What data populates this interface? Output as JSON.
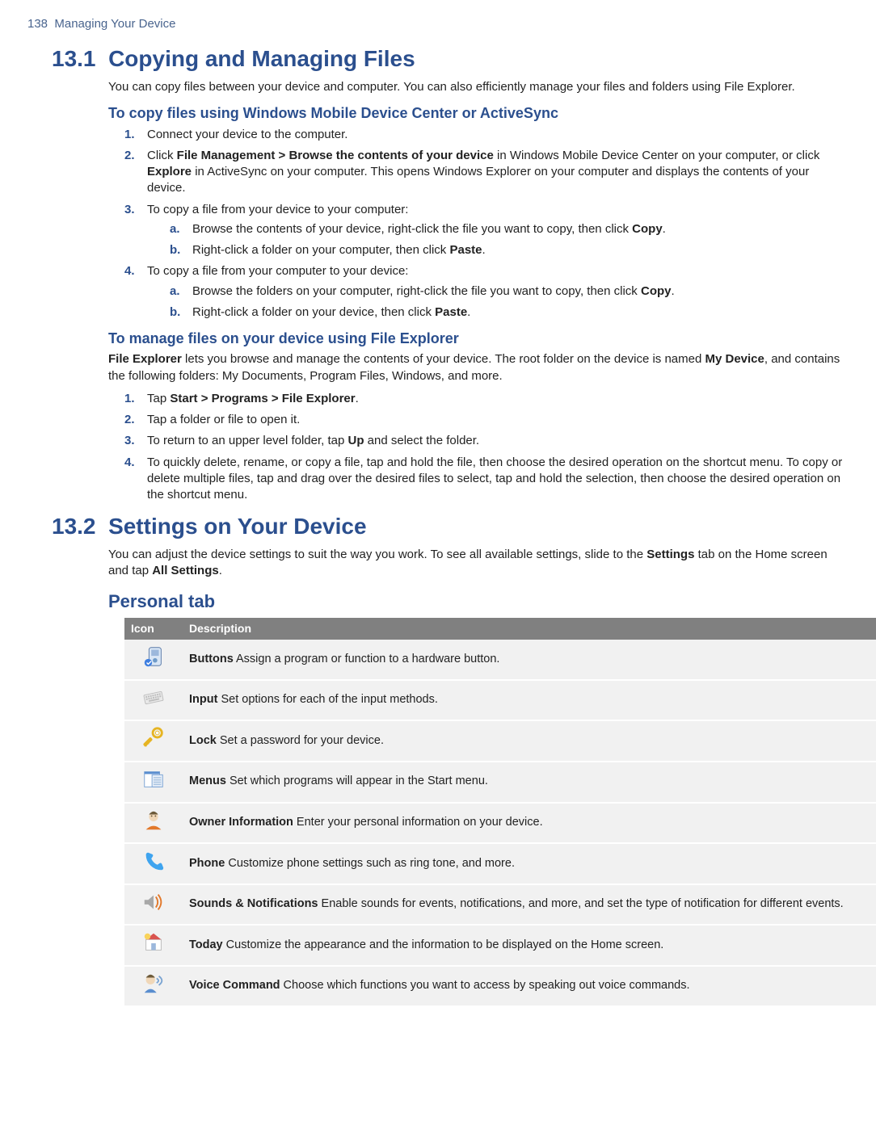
{
  "page": {
    "number": "138",
    "header": "Managing Your Device"
  },
  "section1": {
    "number": "13.1",
    "title": "Copying and Managing Files",
    "intro": "You can copy files between your device and computer. You can also efficiently manage your files and folders using File Explorer.",
    "sub1_title": "To copy files using Windows Mobile Device Center or ActiveSync",
    "s1_items": {
      "i1": "Connect your device to the computer.",
      "i2_p1": "Click ",
      "i2_b1": "File Management > Browse the contents of your device",
      "i2_p2": " in Windows Mobile Device Center on your computer, or click ",
      "i2_b2": "Explore",
      "i2_p3": " in ActiveSync on your computer. This opens Windows Explorer on your computer and displays the contents of your device.",
      "i3": "To copy a file from your device to your computer:",
      "i3a_p1": "Browse the contents of your device, right-click the file you want to copy, then click ",
      "i3a_b1": "Copy",
      "i3a_p2": ".",
      "i3b_p1": "Right-click a folder on your computer, then click ",
      "i3b_b1": "Paste",
      "i3b_p2": ".",
      "i4": "To copy a file from your computer to your device:",
      "i4a_p1": "Browse the folders on your computer, right-click the file you want to copy, then click ",
      "i4a_b1": "Copy",
      "i4a_p2": ".",
      "i4b_p1": "Right-click a folder on your device, then click ",
      "i4b_b1": "Paste",
      "i4b_p2": "."
    },
    "sub2_title": "To manage files on your device using File Explorer",
    "sub2_intro_b1": "File Explorer",
    "sub2_intro_p1": " lets you browse and manage the contents of your device. The root folder on the device is named ",
    "sub2_intro_b2": "My Device",
    "sub2_intro_p2": ", and contains the following folders: My Documents, Program Files, Windows, and more.",
    "s2_items": {
      "i1_p1": "Tap ",
      "i1_b1": "Start > Programs > File Explorer",
      "i1_p2": ".",
      "i2": "Tap a folder or file to open it.",
      "i3_p1": "To return to an upper level folder, tap ",
      "i3_b1": "Up",
      "i3_p2": " and select the folder.",
      "i4": "To quickly delete, rename, or copy a file, tap and hold the file, then choose the desired operation on the shortcut menu. To copy or delete multiple files, tap and drag over the desired files to select, tap and hold the selection, then choose the desired operation on the shortcut menu."
    }
  },
  "section2": {
    "number": "13.2",
    "title": "Settings on Your Device",
    "intro_p1": "You can adjust the device settings to suit the way you work. To see all available settings, slide to the ",
    "intro_b1": "Settings",
    "intro_p2": " tab on the Home screen and tap ",
    "intro_b2": "All Settings",
    "intro_p3": ".",
    "personal_tab": "Personal tab",
    "table": {
      "h_icon": "Icon",
      "h_desc": "Description",
      "rows": [
        {
          "name": "Buttons",
          "desc": "  Assign a program or function to a hardware button."
        },
        {
          "name": "Input",
          "desc": "  Set options for each of the input methods."
        },
        {
          "name": "Lock",
          "desc": "  Set a password for your device."
        },
        {
          "name": "Menus",
          "desc": "  Set which programs will appear in the Start menu."
        },
        {
          "name": "Owner Information",
          "desc": "  Enter your personal information on your device."
        },
        {
          "name": "Phone",
          "desc": "  Customize phone settings such as ring tone, and more."
        },
        {
          "name": "Sounds & Notifications",
          "desc": "  Enable sounds for events, notifications, and more, and set the type of notification for different events."
        },
        {
          "name": "Today",
          "desc": "  Customize the appearance and the information to be displayed on the Home screen."
        },
        {
          "name": "Voice Command",
          "desc": "  Choose which functions you want to access by speaking out voice commands."
        }
      ]
    }
  }
}
